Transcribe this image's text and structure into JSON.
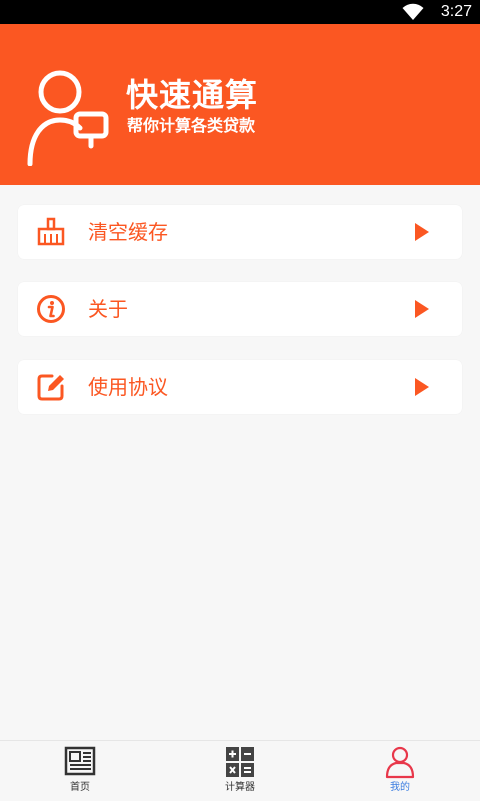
{
  "status_bar": {
    "time": "3:27"
  },
  "header": {
    "title": "快速通算",
    "subtitle": "帮你计算各类贷款"
  },
  "menu": [
    {
      "label": "清空缓存",
      "icon": "broom-icon"
    },
    {
      "label": "关于",
      "icon": "info-icon"
    },
    {
      "label": "使用协议",
      "icon": "edit-icon"
    }
  ],
  "tabs": [
    {
      "label": "首页",
      "icon": "newspaper-icon"
    },
    {
      "label": "计算器",
      "icon": "calculator-icon"
    },
    {
      "label": "我的",
      "icon": "user-icon",
      "active": true
    }
  ],
  "colors": {
    "accent": "#fb5722",
    "active_tab": "#3b7de0",
    "background": "#f7f7f7"
  }
}
